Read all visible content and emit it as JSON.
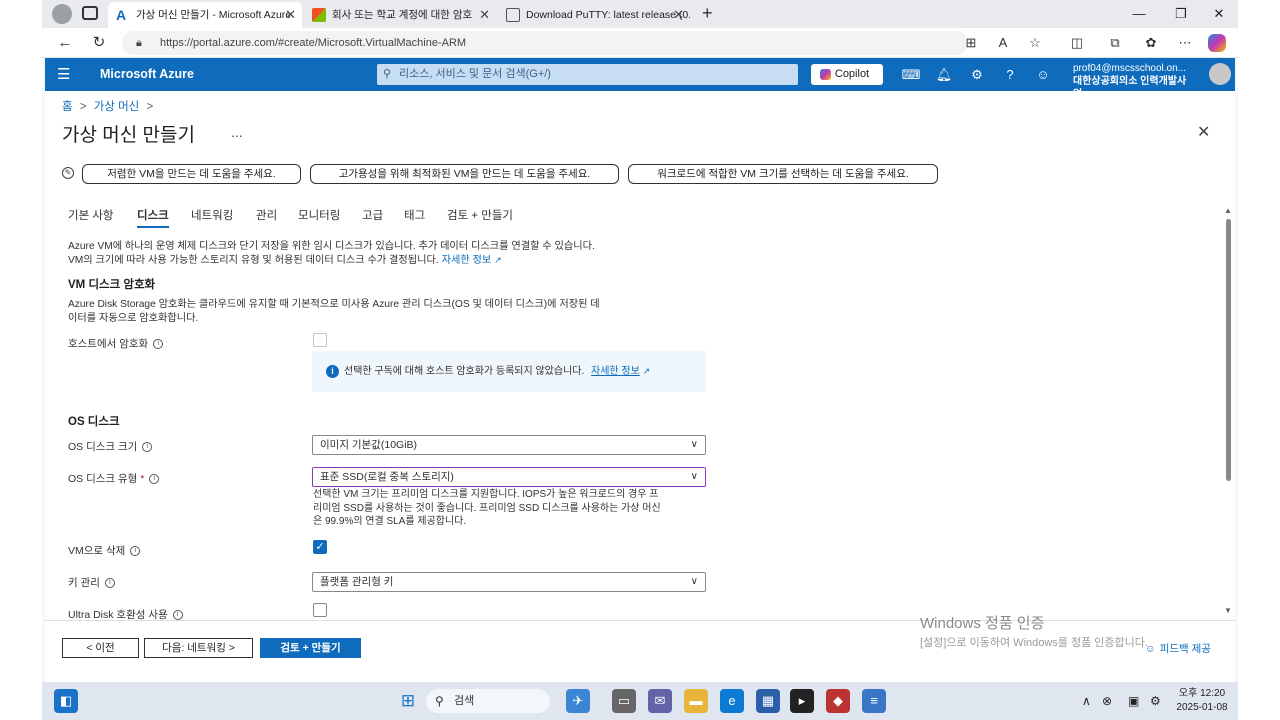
{
  "browser": {
    "tabs": [
      {
        "title": "가상 머신 만들기 - Microsoft Azure",
        "active": true
      },
      {
        "title": "회사 또는 학교 계정에 대한 암호",
        "active": false
      },
      {
        "title": "Download PuTTY: latest release (0.",
        "active": false
      }
    ],
    "url": "https://portal.azure.com/#create/Microsoft.VirtualMachine-ARM"
  },
  "azure_header": {
    "brand": "Microsoft Azure",
    "search_placeholder": "리소스, 서비스 및 문서 검색(G+/)",
    "copilot_label": "Copilot",
    "account_email": "prof04@mscsschool.on...",
    "account_org": "대한상공회의소 인력개발사업..."
  },
  "breadcrumb": {
    "home": "홈",
    "sep": ">",
    "current": "가상 머신"
  },
  "page_title": "가상 머신 만들기",
  "page_menu": "...",
  "assist_pills": [
    "저렴한 VM을 만드는 데 도움을 주세요.",
    "고가용성을 위해 최적화된 VM을 만드는 데 도움을 주세요.",
    "워크로드에 적합한 VM 크기를 선택하는 데 도움을 주세요."
  ],
  "wizard_tabs": [
    "기본 사항",
    "디스크",
    "네트워킹",
    "관리",
    "모니터링",
    "고급",
    "태그",
    "검토 + 만들기"
  ],
  "active_tab": "디스크",
  "intro": {
    "line1": "Azure VM에 하나의 운영 체제 디스크와 단기 저장을 위한 임시 디스크가 있습니다. 추가 데이터 디스크를 연결할 수 있습니다.",
    "line2": "VM의 크기에 따라 사용 가능한 스토리지 유형 및 허용된 데이터 디스크 수가 결정됩니다.",
    "learn_more": "자세한 정보"
  },
  "encryption": {
    "heading": "VM 디스크 암호화",
    "desc_line1": "Azure Disk Storage 암호화는 클라우드에 유지할 때 기본적으로 미사용 Azure 관리 디스크(OS 및 데이터 디스크)에 저장된 데",
    "desc_line2": "이터를 자동으로 암호화합니다.",
    "host_label": "호스트에서 암호화",
    "host_checked": false,
    "info_message": "선택한 구독에 대해 호스트 암호화가 등록되지 않았습니다.",
    "info_link": "자세한 정보"
  },
  "os_disk": {
    "heading": "OS 디스크",
    "size_label": "OS 디스크 크기",
    "size_value": "이미지 기본값(10GiB)",
    "type_label": "OS 디스크 유형",
    "required_mark": "*",
    "type_value": "표준 SSD(로컬 중복 스토리지)",
    "type_note_line1": "선택한 VM 크기는 프리미엄 디스크를 지원합니다. IOPS가 높은 워크로드의 경우 프",
    "type_note_line2": "리미엄 SSD를 사용하는 것이 좋습니다. 프리미엄 SSD 디스크를 사용하는 가상 머신",
    "type_note_line3": "은 99.9%의 연결 SLA를 제공합니다.",
    "delete_label": "VM으로 삭제",
    "delete_checked": true,
    "key_label": "키 관리",
    "key_value": "플랫폼 관리형 키",
    "ultra_label": "Ultra Disk 호환성 사용",
    "ultra_checked": false
  },
  "footer": {
    "prev": "< 이전",
    "next": "다음: 네트워킹 >",
    "review": "검토 + 만들기",
    "feedback": "피드백 제공"
  },
  "watermark": {
    "title": "Windows 정품 인증",
    "subtitle": "[설정]으로 이동하여 Windows를 정품 인증합니다."
  },
  "taskbar": {
    "search_label": "검색",
    "time": "오후 12:20",
    "date": "2025-01-08"
  }
}
